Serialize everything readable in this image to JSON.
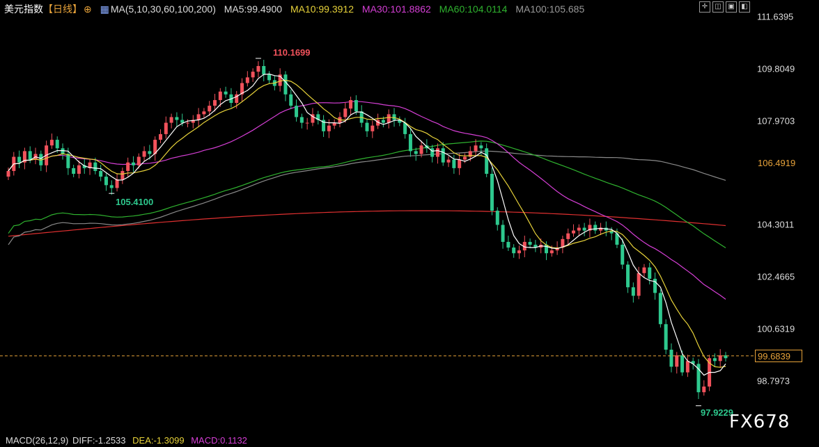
{
  "header": {
    "symbol": "美元指数",
    "period": "【日线】",
    "ma_label": "MA(5,10,30,60,100,200)",
    "ma5": "MA5:99.4900",
    "ma10": "MA10:99.3912",
    "ma30": "MA30:101.8862",
    "ma60": "MA60:104.0114",
    "ma100": "MA100:105.685"
  },
  "colors": {
    "up": "#f2525c",
    "down": "#2ec98e",
    "ma5": "#ffffff",
    "ma10": "#e8d33a",
    "ma30": "#d63fd6",
    "ma60": "#2fb32f",
    "ma100": "#8a8a8a",
    "ma200": "#e03030",
    "price_line": "#e8a33a",
    "highlight_tag": "#e8a33a"
  },
  "toolbar_icons": [
    "crosshair-icon",
    "split-view-icon",
    "fullscreen-icon",
    "restore-icon"
  ],
  "yaxis": {
    "ticks": [
      "111.6395",
      "109.8049",
      "107.9703",
      "104.3011",
      "102.4665",
      "100.6319",
      "98.7973"
    ],
    "tag_highlight": "106.4919",
    "tag_current": "99.6839"
  },
  "annotations": {
    "high": "110.1699",
    "low1": "105.4100",
    "low2": "97.9229"
  },
  "macd": {
    "label": "MACD(26,12,9)",
    "diff": "DIFF:-1.2533",
    "dea": "DEA:-1.3099",
    "macd": "MACD:0.1132"
  },
  "watermark": "FX678",
  "chart_data": {
    "type": "candlestick",
    "ylim": [
      97.9229,
      111.6395
    ],
    "yticks": [
      111.6395,
      109.8049,
      107.9703,
      106.4919,
      104.3011,
      102.4665,
      100.6319,
      99.6839,
      98.7973
    ],
    "high_marker": 110.1699,
    "low_marker_1": 105.41,
    "low_marker_2": 97.9229,
    "current_price": 99.6839,
    "ma_current": {
      "MA5": 99.49,
      "MA10": 99.3912,
      "MA30": 101.8862,
      "MA60": 104.0114,
      "MA100": 105.685
    },
    "close_series": [
      106.2,
      106.7,
      106.5,
      106.9,
      106.6,
      106.8,
      106.4,
      107.1,
      107.3,
      107.0,
      106.8,
      106.3,
      106.1,
      106.4,
      106.3,
      106.5,
      106.2,
      106.0,
      105.7,
      105.6,
      105.9,
      106.2,
      106.5,
      106.4,
      106.7,
      106.9,
      106.8,
      107.3,
      107.5,
      107.9,
      108.1,
      108.0,
      107.9,
      107.9,
      108.0,
      108.2,
      108.3,
      108.5,
      108.7,
      109.0,
      108.9,
      108.6,
      108.9,
      109.3,
      109.5,
      109.7,
      109.9,
      109.6,
      109.4,
      109.2,
      109.6,
      108.9,
      108.5,
      108.1,
      107.9,
      107.9,
      108.2,
      108.0,
      107.6,
      107.8,
      107.9,
      108.1,
      108.4,
      108.7,
      108.3,
      107.9,
      107.6,
      107.8,
      108.0,
      107.9,
      108.2,
      108.0,
      107.9,
      107.5,
      106.9,
      106.8,
      107.1,
      107.0,
      106.7,
      107.0,
      106.5,
      106.6,
      106.3,
      106.6,
      106.7,
      106.9,
      107.1,
      107.0,
      106.1,
      104.8,
      104.3,
      103.7,
      103.5,
      103.3,
      103.4,
      103.7,
      103.6,
      103.5,
      103.6,
      103.3,
      103.4,
      103.5,
      103.8,
      104.0,
      104.1,
      104.2,
      104.1,
      104.3,
      104.1,
      104.2,
      104.1,
      104.0,
      103.6,
      102.9,
      102.1,
      101.8,
      102.6,
      102.8,
      102.4,
      101.9,
      100.8,
      99.9,
      99.3,
      99.7,
      99.1,
      99.5,
      99.4,
      98.4,
      98.6,
      99.6,
      99.5,
      99.7,
      99.6
    ]
  }
}
